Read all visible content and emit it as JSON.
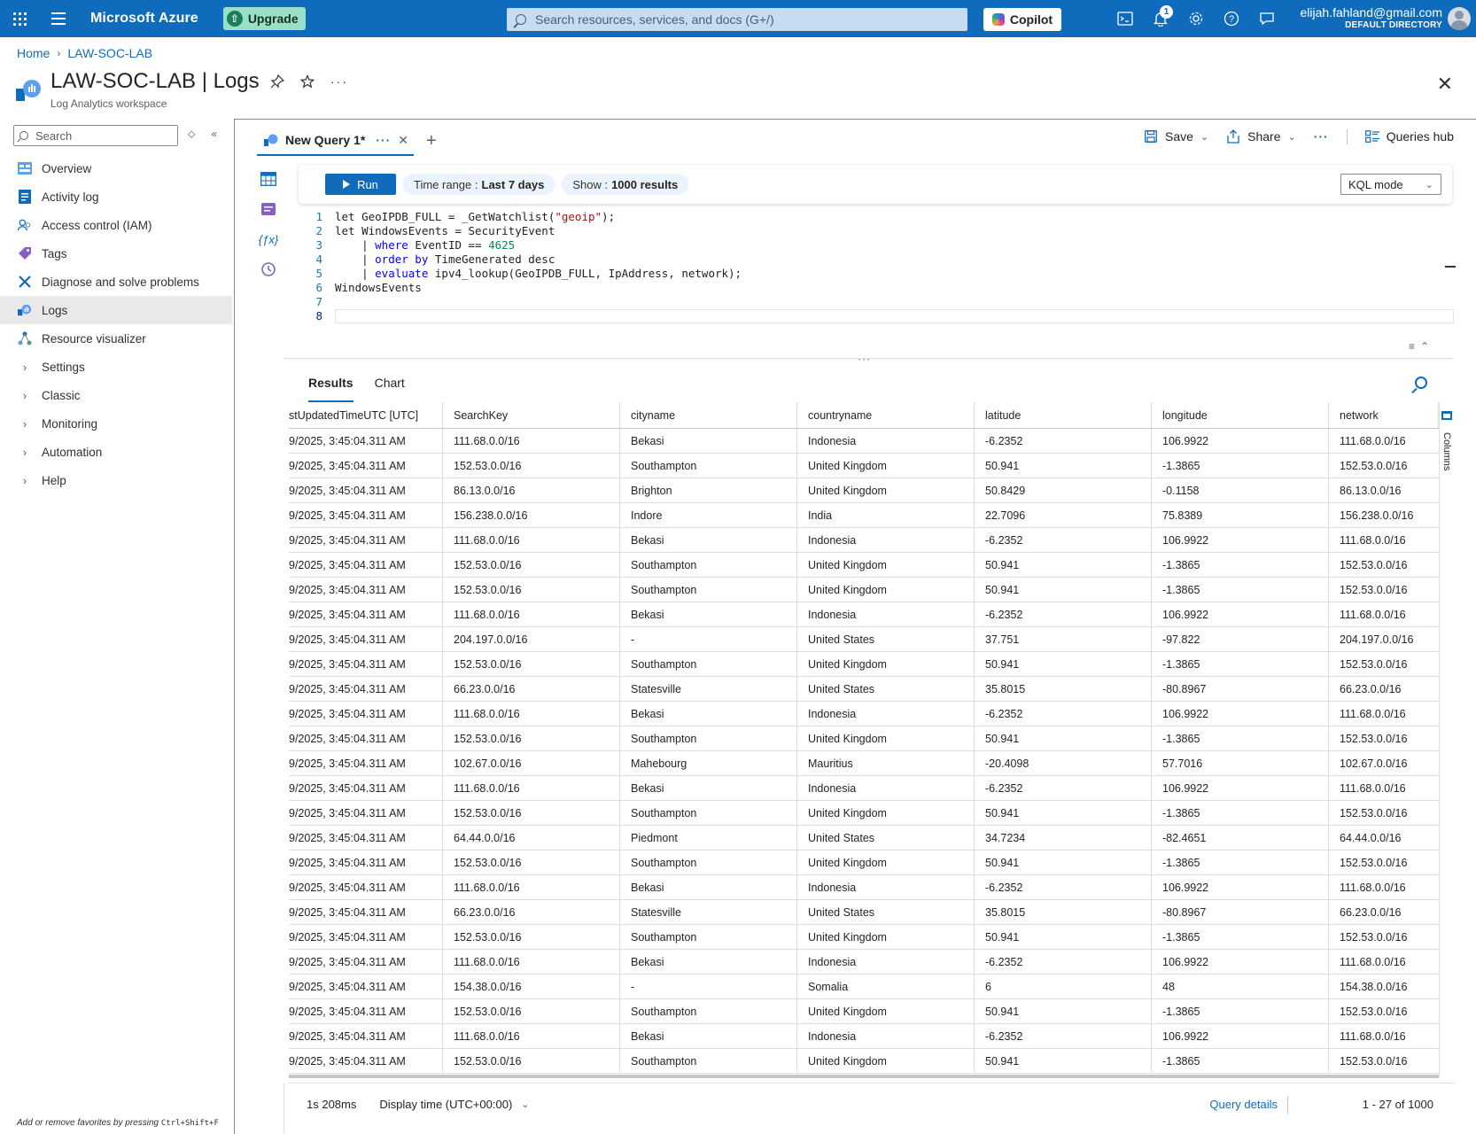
{
  "topbar": {
    "brand": "Microsoft Azure",
    "upgrade_label": "Upgrade",
    "search_placeholder": "Search resources, services, and docs (G+/)",
    "copilot_label": "Copilot",
    "notification_count": "1",
    "account_email": "elijah.fahland@gmail.com",
    "account_directory": "DEFAULT DIRECTORY",
    "icons": [
      "waffle-icon",
      "hamburger-icon",
      "cloud-shell-icon",
      "bell-icon",
      "gear-icon",
      "help-icon",
      "feedback-icon",
      "avatar"
    ],
    "brand_color": "#0f6cbd"
  },
  "breadcrumb": {
    "home": "Home",
    "resource": "LAW-SOC-LAB"
  },
  "header": {
    "title": "LAW-SOC-LAB | Logs",
    "subtitle": "Log Analytics workspace"
  },
  "nav": {
    "search_placeholder": "Search",
    "items": [
      {
        "label": "Overview",
        "icon": "overview-icon"
      },
      {
        "label": "Activity log",
        "icon": "activity-log-icon"
      },
      {
        "label": "Access control (IAM)",
        "icon": "iam-icon"
      },
      {
        "label": "Tags",
        "icon": "tag-icon"
      },
      {
        "label": "Diagnose and solve problems",
        "icon": "wrench-icon"
      },
      {
        "label": "Logs",
        "icon": "logs-icon",
        "active": true
      },
      {
        "label": "Resource visualizer",
        "icon": "visualizer-icon"
      },
      {
        "label": "Settings",
        "expandable": true
      },
      {
        "label": "Classic",
        "expandable": true
      },
      {
        "label": "Monitoring",
        "expandable": true
      },
      {
        "label": "Automation",
        "expandable": true
      },
      {
        "label": "Help",
        "expandable": true
      }
    ],
    "favorites_hint_prefix": "Add or remove favorites by pressing ",
    "favorites_hint_keys": "Ctrl+Shift+F"
  },
  "query_tab": {
    "label": "New Query 1*"
  },
  "actions": {
    "save": "Save",
    "share": "Share",
    "queries_hub": "Queries hub"
  },
  "toolbar": {
    "run": "Run",
    "time_range_label": "Time range :",
    "time_range_value": "Last 7 days",
    "show_label": "Show :",
    "show_value": "1000 results",
    "mode": "KQL mode"
  },
  "editor": {
    "lines": [
      {
        "n": "1",
        "code": "let GeoIPDB_FULL = _GetWatchlist(\"geoip\");"
      },
      {
        "n": "2",
        "code": "let WindowsEvents = SecurityEvent"
      },
      {
        "n": "3",
        "code": "    | where EventID == 4625"
      },
      {
        "n": "4",
        "code": "    | order by TimeGenerated desc"
      },
      {
        "n": "5",
        "code": "    | evaluate ipv4_lookup(GeoIPDB_FULL, IpAddress, network);"
      },
      {
        "n": "6",
        "code": "WindowsEvents"
      },
      {
        "n": "7",
        "code": ""
      },
      {
        "n": "8",
        "code": ""
      }
    ]
  },
  "results": {
    "tabs": [
      "Results",
      "Chart"
    ],
    "columns": [
      "stUpdatedTimeUTC [UTC]",
      "SearchKey",
      "cityname",
      "countryname",
      "latitude",
      "longitude",
      "network"
    ],
    "columns_panel_label": "Columns",
    "rows": [
      [
        "9/2025, 3:45:04.311 AM",
        "111.68.0.0/16",
        "Bekasi",
        "Indonesia",
        "-6.2352",
        "106.9922",
        "111.68.0.0/16"
      ],
      [
        "9/2025, 3:45:04.311 AM",
        "152.53.0.0/16",
        "Southampton",
        "United Kingdom",
        "50.941",
        "-1.3865",
        "152.53.0.0/16"
      ],
      [
        "9/2025, 3:45:04.311 AM",
        "86.13.0.0/16",
        "Brighton",
        "United Kingdom",
        "50.8429",
        "-0.1158",
        "86.13.0.0/16"
      ],
      [
        "9/2025, 3:45:04.311 AM",
        "156.238.0.0/16",
        "Indore",
        "India",
        "22.7096",
        "75.8389",
        "156.238.0.0/16"
      ],
      [
        "9/2025, 3:45:04.311 AM",
        "111.68.0.0/16",
        "Bekasi",
        "Indonesia",
        "-6.2352",
        "106.9922",
        "111.68.0.0/16"
      ],
      [
        "9/2025, 3:45:04.311 AM",
        "152.53.0.0/16",
        "Southampton",
        "United Kingdom",
        "50.941",
        "-1.3865",
        "152.53.0.0/16"
      ],
      [
        "9/2025, 3:45:04.311 AM",
        "152.53.0.0/16",
        "Southampton",
        "United Kingdom",
        "50.941",
        "-1.3865",
        "152.53.0.0/16"
      ],
      [
        "9/2025, 3:45:04.311 AM",
        "111.68.0.0/16",
        "Bekasi",
        "Indonesia",
        "-6.2352",
        "106.9922",
        "111.68.0.0/16"
      ],
      [
        "9/2025, 3:45:04.311 AM",
        "204.197.0.0/16",
        "-",
        "United States",
        "37.751",
        "-97.822",
        "204.197.0.0/16"
      ],
      [
        "9/2025, 3:45:04.311 AM",
        "152.53.0.0/16",
        "Southampton",
        "United Kingdom",
        "50.941",
        "-1.3865",
        "152.53.0.0/16"
      ],
      [
        "9/2025, 3:45:04.311 AM",
        "66.23.0.0/16",
        "Statesville",
        "United States",
        "35.8015",
        "-80.8967",
        "66.23.0.0/16"
      ],
      [
        "9/2025, 3:45:04.311 AM",
        "111.68.0.0/16",
        "Bekasi",
        "Indonesia",
        "-6.2352",
        "106.9922",
        "111.68.0.0/16"
      ],
      [
        "9/2025, 3:45:04.311 AM",
        "152.53.0.0/16",
        "Southampton",
        "United Kingdom",
        "50.941",
        "-1.3865",
        "152.53.0.0/16"
      ],
      [
        "9/2025, 3:45:04.311 AM",
        "102.67.0.0/16",
        "Mahebourg",
        "Mauritius",
        "-20.4098",
        "57.7016",
        "102.67.0.0/16"
      ],
      [
        "9/2025, 3:45:04.311 AM",
        "111.68.0.0/16",
        "Bekasi",
        "Indonesia",
        "-6.2352",
        "106.9922",
        "111.68.0.0/16"
      ],
      [
        "9/2025, 3:45:04.311 AM",
        "152.53.0.0/16",
        "Southampton",
        "United Kingdom",
        "50.941",
        "-1.3865",
        "152.53.0.0/16"
      ],
      [
        "9/2025, 3:45:04.311 AM",
        "64.44.0.0/16",
        "Piedmont",
        "United States",
        "34.7234",
        "-82.4651",
        "64.44.0.0/16"
      ],
      [
        "9/2025, 3:45:04.311 AM",
        "152.53.0.0/16",
        "Southampton",
        "United Kingdom",
        "50.941",
        "-1.3865",
        "152.53.0.0/16"
      ],
      [
        "9/2025, 3:45:04.311 AM",
        "111.68.0.0/16",
        "Bekasi",
        "Indonesia",
        "-6.2352",
        "106.9922",
        "111.68.0.0/16"
      ],
      [
        "9/2025, 3:45:04.311 AM",
        "66.23.0.0/16",
        "Statesville",
        "United States",
        "35.8015",
        "-80.8967",
        "66.23.0.0/16"
      ],
      [
        "9/2025, 3:45:04.311 AM",
        "152.53.0.0/16",
        "Southampton",
        "United Kingdom",
        "50.941",
        "-1.3865",
        "152.53.0.0/16"
      ],
      [
        "9/2025, 3:45:04.311 AM",
        "111.68.0.0/16",
        "Bekasi",
        "Indonesia",
        "-6.2352",
        "106.9922",
        "111.68.0.0/16"
      ],
      [
        "9/2025, 3:45:04.311 AM",
        "154.38.0.0/16",
        "-",
        "Somalia",
        "6",
        "48",
        "154.38.0.0/16"
      ],
      [
        "9/2025, 3:45:04.311 AM",
        "152.53.0.0/16",
        "Southampton",
        "United Kingdom",
        "50.941",
        "-1.3865",
        "152.53.0.0/16"
      ],
      [
        "9/2025, 3:45:04.311 AM",
        "111.68.0.0/16",
        "Bekasi",
        "Indonesia",
        "-6.2352",
        "106.9922",
        "111.68.0.0/16"
      ],
      [
        "9/2025, 3:45:04.311 AM",
        "152.53.0.0/16",
        "Southampton",
        "United Kingdom",
        "50.941",
        "-1.3865",
        "152.53.0.0/16"
      ]
    ]
  },
  "footer": {
    "duration": "1s 208ms",
    "display_time": "Display time (UTC+00:00)",
    "query_details": "Query details",
    "pagination": "1 - 27 of 1000"
  }
}
